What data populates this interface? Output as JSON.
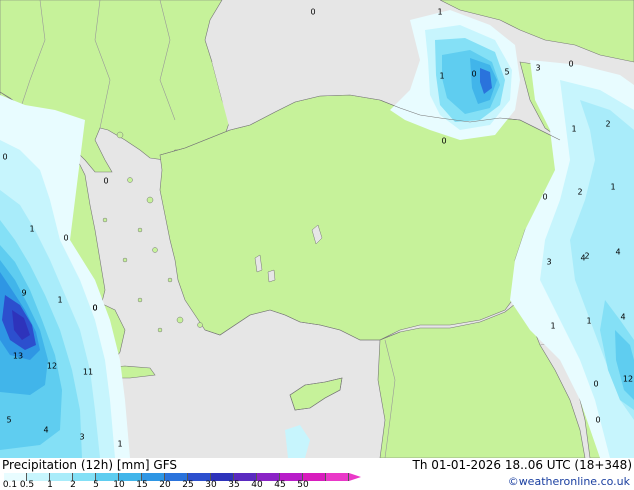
{
  "map": {
    "colors": {
      "land": "#c6f29a",
      "sea": "#e6e6e6",
      "coast": "#777777",
      "border": "#999999"
    },
    "contour_labels": [
      "0",
      "1",
      "1",
      "0",
      "5",
      "3",
      "0",
      "0",
      "0",
      "1",
      "2",
      "0",
      "0",
      "1",
      "0",
      "2",
      "1",
      "0",
      "2",
      "4",
      "3",
      "4",
      "9",
      "1",
      "0",
      "1",
      "1",
      "4",
      "0",
      "13",
      "12",
      "11",
      "5",
      "4",
      "3",
      "1",
      "0",
      "12"
    ]
  },
  "footer": {
    "title": "Precipitation (12h) [mm] GFS",
    "timestamp": "Th 01-01-2026 18..06 UTC (18+348)",
    "credit": "©weatheronline.co.uk"
  },
  "legend": {
    "ticks": [
      "0.1",
      "0.5",
      "1",
      "2",
      "5",
      "10",
      "15",
      "20",
      "25",
      "30",
      "35",
      "40",
      "45",
      "50"
    ],
    "colors": [
      "#e8fcff",
      "#c7f5fd",
      "#a9ecfa",
      "#84e0f6",
      "#5fcdf0",
      "#41b5ea",
      "#2e96e4",
      "#2a73dc",
      "#2c4fce",
      "#2e33bb",
      "#5a2ac0",
      "#8a23c6",
      "#b81dc9",
      "#d81cbd",
      "#ea38c8"
    ]
  }
}
